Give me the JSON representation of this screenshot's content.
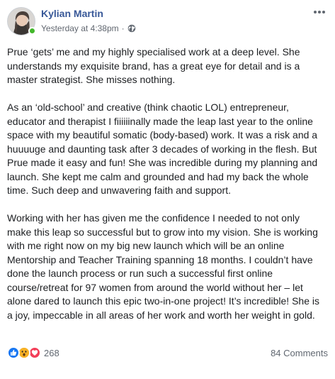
{
  "post": {
    "author": "Kylian Martin",
    "timestamp": "Yesterday at 4:38pm",
    "separator": "·",
    "privacy_icon": "globe-icon",
    "paragraphs": [
      "Prue ‘gets’ me and my highly specialised work at a deep level. She understands my exquisite brand, has a great eye for detail and is a master strategist. She misses nothing.",
      "As an ‘old-school’ and creative (think chaotic LOL) entrepreneur, educator and therapist I fiiiiiinally made the leap last year to the online space with my beautiful somatic (body-based) work. It was a risk and a huuuuge and daunting task after 3 decades of working in the flesh. But Prue made it easy and fun! She was incredible during my planning and launch. She kept me calm and grounded and had my back the whole time. Such deep and unwavering faith and support.",
      "Working with her has given me the confidence I needed to not only make this leap so successful but to grow into my vision. She is working with me right now on my big new launch which will be an online Mentorship and Teacher Training spanning 18 months. I couldn’t have done the launch process or run such a successful first online course/retreat for 97 women from around the world without her – let alone dared to launch this epic two-in-one project! It’s incredible! She is a joy, impeccable in all areas of her work and worth her weight in gold."
    ]
  },
  "footer": {
    "reactions": [
      "like-icon",
      "wow-icon",
      "love-icon"
    ],
    "reaction_count": "268",
    "comments_label": "84 Comments"
  },
  "colors": {
    "author": "#385898",
    "meta": "#616770",
    "online": "#42b72a",
    "like": "#1877f2",
    "wow": "#f7b125",
    "love": "#f33e58"
  }
}
